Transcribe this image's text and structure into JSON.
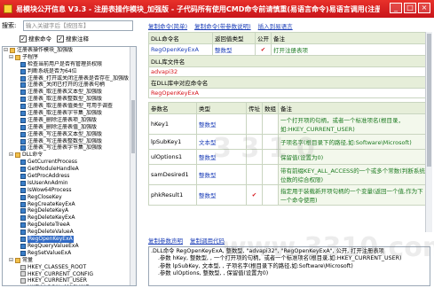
{
  "window": {
    "title": "易模块公开信息 V3.3 - 注册表操作模块_加强版 - 子代码所有使用CMD命令前请慎重(易语言命令)易语言调用(注册表操作模块...",
    "minimize": "_",
    "maximize": "□",
    "close": "×"
  },
  "search": {
    "label": "搜索:",
    "placeholder": "输入关键字后【按回车】",
    "options": [
      {
        "label": "搜索命令",
        "checked": true
      },
      {
        "label": "搜索注释",
        "checked": true
      }
    ]
  },
  "tree": [
    {
      "indent": 0,
      "toggle": "⊟",
      "icon": "folder",
      "label": "注册表操作模块_加强版"
    },
    {
      "indent": 1,
      "toggle": "⊟",
      "icon": "folder",
      "label": "子程序"
    },
    {
      "indent": 2,
      "toggle": "",
      "icon": "fn",
      "label": "检查当前用户是否有管理员权限"
    },
    {
      "indent": 2,
      "toggle": "",
      "icon": "fn",
      "label": "判断系统是否为64位"
    },
    {
      "indent": 2,
      "toggle": "",
      "icon": "fn",
      "label": "注册表_打开或关闭注册表是否存在_加强版"
    },
    {
      "indent": 2,
      "toggle": "",
      "icon": "fn",
      "label": "注册表_关闭已打开的注册表句柄"
    },
    {
      "indent": 2,
      "toggle": "",
      "icon": "fn",
      "label": "注册表_取注册表文本型_加强版"
    },
    {
      "indent": 2,
      "toggle": "",
      "icon": "fn",
      "label": "注册表_取注册表整数型_加强版"
    },
    {
      "indent": 2,
      "toggle": "",
      "icon": "fn",
      "label": "注册表_取注册表值类型_可用于调查"
    },
    {
      "indent": 2,
      "toggle": "",
      "icon": "fn",
      "label": "注册表_取注册表字节集_加强版"
    },
    {
      "indent": 2,
      "toggle": "",
      "icon": "fn",
      "label": "注册表_删除注册表项_加强版"
    },
    {
      "indent": 2,
      "toggle": "",
      "icon": "fn",
      "label": "注册表_删除注册表值_加强版"
    },
    {
      "indent": 2,
      "toggle": "",
      "icon": "fn",
      "label": "注册表_写注册表文本型_加强版"
    },
    {
      "indent": 2,
      "toggle": "",
      "icon": "fn",
      "label": "注册表_写注册表整数型_加强版"
    },
    {
      "indent": 2,
      "toggle": "",
      "icon": "fn",
      "label": "注册表_写注册表字节集_加强版"
    },
    {
      "indent": 1,
      "toggle": "⊟",
      "icon": "folder",
      "label": "DLL命令"
    },
    {
      "indent": 2,
      "toggle": "",
      "icon": "fn",
      "label": "GetCurrentProcess"
    },
    {
      "indent": 2,
      "toggle": "",
      "icon": "fn",
      "label": "GetModuleHandleA"
    },
    {
      "indent": 2,
      "toggle": "",
      "icon": "fn",
      "label": "GetProcAddress"
    },
    {
      "indent": 2,
      "toggle": "",
      "icon": "fn",
      "label": "IsUserAnAdmin"
    },
    {
      "indent": 2,
      "toggle": "",
      "icon": "fn",
      "label": "IsWow64Process"
    },
    {
      "indent": 2,
      "toggle": "",
      "icon": "fn",
      "label": "RegCloseKey"
    },
    {
      "indent": 2,
      "toggle": "",
      "icon": "fn",
      "label": "RegCreateKeyExA"
    },
    {
      "indent": 2,
      "toggle": "",
      "icon": "fn",
      "label": "RegDeleteKeyA"
    },
    {
      "indent": 2,
      "toggle": "",
      "icon": "fn",
      "label": "RegDeleteKeyExA"
    },
    {
      "indent": 2,
      "toggle": "",
      "icon": "fn",
      "label": "RegDeleteTreeA"
    },
    {
      "indent": 2,
      "toggle": "",
      "icon": "fn",
      "label": "RegDeleteValueA"
    },
    {
      "indent": 2,
      "toggle": "",
      "icon": "fn",
      "label": "RegOpenKeyExA",
      "selected": true
    },
    {
      "indent": 2,
      "toggle": "",
      "icon": "fn",
      "label": "RegQueryValueExA"
    },
    {
      "indent": 2,
      "toggle": "",
      "icon": "fn",
      "label": "RegSetValueExA"
    },
    {
      "indent": 1,
      "toggle": "⊟",
      "icon": "folder",
      "label": "常量"
    },
    {
      "indent": 2,
      "toggle": "",
      "icon": "eq",
      "label": "HKEY_CLASSES_ROOT"
    },
    {
      "indent": 2,
      "toggle": "",
      "icon": "eq",
      "label": "HKEY_CURRENT_CONFIG"
    },
    {
      "indent": 2,
      "toggle": "",
      "icon": "eq",
      "label": "HKEY_CURRENT_USER"
    },
    {
      "indent": 2,
      "toggle": "",
      "icon": "eq",
      "label": "HKEY_LOCAL_MACHINE"
    }
  ],
  "tabs": [
    "复制命令(简单)",
    "复制命令(带参数说明)",
    "插入到易语言"
  ],
  "dll": {
    "head": {
      "name_label": "DLL命令名",
      "ret_label": "返回值类型",
      "public_label": "公开",
      "remark_label": "备注"
    },
    "name": "RegOpenKeyExA",
    "ret": "整数型",
    "public_mark": "✔",
    "remark": "打开注册表项",
    "lib_label": "DLL库文件名",
    "lib": "advapi32",
    "entry_label": "在DLL库中对应命令名",
    "entry": "RegOpenKeyExA"
  },
  "params": {
    "head": {
      "name": "参数名",
      "type": "类型",
      "addr": "传址",
      "array": "数组",
      "remark": "备注"
    },
    "rows": [
      {
        "name": "hKey1",
        "type": "整数型",
        "addr": "",
        "array": "",
        "remark": "一个打开项的句柄，或者一个标准项名(根目录，如:HKEY_CURRENT_USER)"
      },
      {
        "name": "lpSubKey1",
        "type": "文本型",
        "addr": "",
        "array": "",
        "remark": "子项名字(根目录下的路径,如:Software\\Microsoft)"
      },
      {
        "name": "ulOptions1",
        "type": "整数型",
        "addr": "",
        "array": "",
        "remark": "保留值(设置为0)"
      },
      {
        "name": "samDesired1",
        "type": "整数型",
        "addr": "",
        "array": "",
        "remark": "带有前缀KEY_ALL_ACCESS的一个或多个常数(判断系统位数的综合权限)"
      },
      {
        "name": "phkResult1",
        "type": "整数型",
        "addr": "✔",
        "array": "",
        "remark": "指定用于装载新开项句柄的一个变量(返回一个值,作为下一个命令使用)"
      }
    ]
  },
  "bottom_links": [
    "复制参数声明",
    "复制调用代码"
  ],
  "code": [
    ".DLL命令 RegOpenKeyExA, 整数型, \"advapi32\", \"RegOpenKeyExA\", 公开, 打开注册表项",
    "    .参数 hKey, 整数型, , 一个打开项的句柄，或者一个标准项名(根目录,如:HKEY_CURRENT_USER)",
    "    .参数 lpSubKey, 文本型, , 子项名字(根目录下的路径,如:Software\\Microsoft)",
    "    .参数 ulOptions, 整数型, , 保留值(设置为0)"
  ],
  "watermarks": [
    "3 3 1 0",
    "www.3310.com"
  ],
  "colors": {
    "accent_red": "#d6141a",
    "link_blue": "#1c3fb8",
    "header_green": "#e6eed9",
    "remark_green": "#1c7a20"
  }
}
